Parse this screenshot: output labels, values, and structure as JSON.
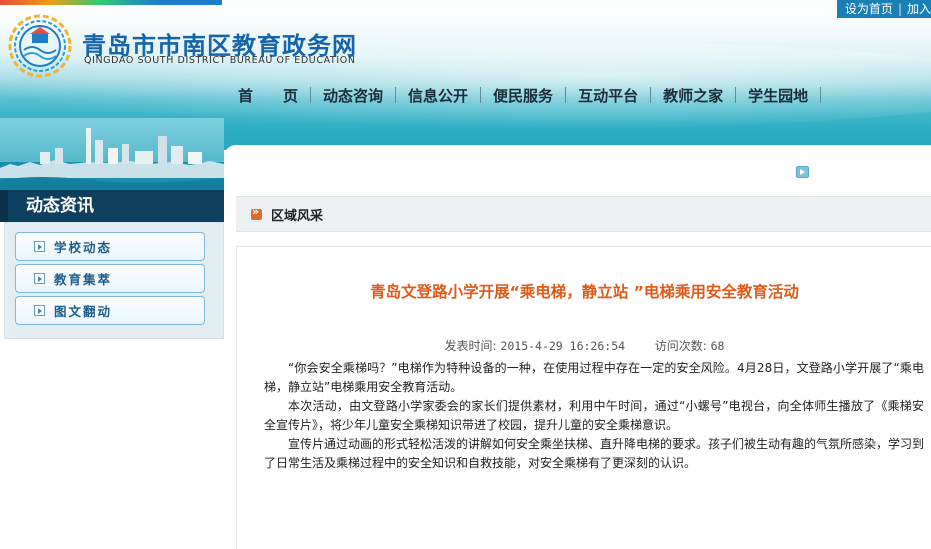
{
  "header": {
    "site_title": "青岛市市南区教育政务网",
    "site_subtitle": "QINGDAO SOUTH DISTRICT BUREAU OF EDUCATION",
    "toplinks": [
      "设为首页",
      "加入"
    ]
  },
  "nav": {
    "items": [
      "首　　页",
      "动态咨询",
      "信息公开",
      "便民服务",
      "互动平台",
      "教师之家",
      "学生园地"
    ]
  },
  "sidebar": {
    "title": "动态资讯",
    "items": [
      "学校动态",
      "教育集萃",
      "图文翻动"
    ]
  },
  "breadcrumb": {
    "label": "区域风采"
  },
  "article": {
    "title": "青岛文登路小学开展“乘电梯，静立站 ”电梯乘用安全教育活动",
    "publish_label": "发表时间:",
    "publish_time": "2015-4-29 16:26:54",
    "views_label": "访问次数:",
    "views": "68",
    "paragraphs": [
      "“你会安全乘梯吗？”电梯作为特种设备的一种，在使用过程中存在一定的安全风险。4月28日，文登路小学开展了“乘电梯，静立站”电梯乘用安全教育活动。",
      "本次活动，由文登路小学家委会的家长们提供素材，利用中午时间，通过“小螺号”电视台，向全体师生播放了《乘梯安全宣传片》，将少年儿童安全乘梯知识带进了校园，提升儿童的安全乘梯意识。",
      "宣传片通过动画的形式轻松活泼的讲解如何安全乘坐扶梯、直升降电梯的要求。孩子们被生动有趣的气氛所感染，学习到了日常生活及乘梯过程中的安全知识和自救技能，对安全乘梯有了更深刻的认识。"
    ]
  },
  "colors": {
    "title_blue": "#1565a8",
    "accent_orange": "#e05a1a",
    "sidebar_dark": "#0d3f5e",
    "header_teal": "#2fb0c5"
  },
  "icons": [
    "logo-mark",
    "up-arrow-icon",
    "breadcrumb-arrow-icon",
    "sidebar-arrow-icon"
  ]
}
